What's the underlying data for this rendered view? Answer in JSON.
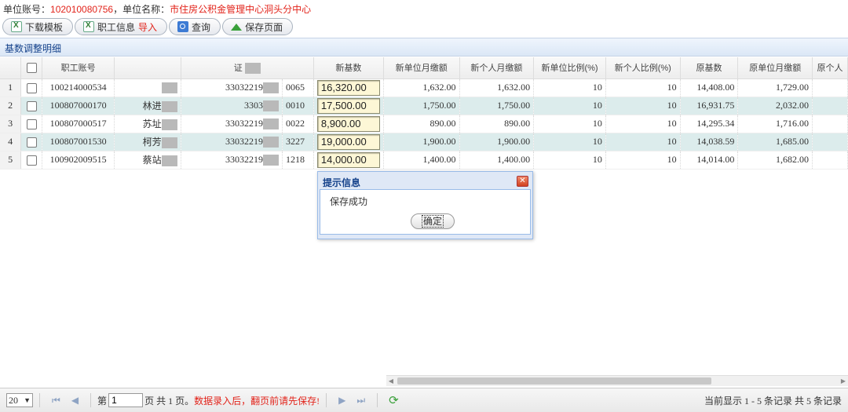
{
  "header": {
    "account_label": "单位账号：",
    "account_value": "102010080756",
    "sep": "，",
    "name_label": "单位名称：",
    "name_value": "市住房公积金管理中心洞头分中心"
  },
  "toolbar": {
    "download": "下载模板",
    "import_a": "职工信息",
    "import_b": "导入",
    "query": "查询",
    "save": "保存页面"
  },
  "panel": {
    "title": "基数调整明细"
  },
  "columns": [
    "职工账号",
    "",
    "证",
    "新基数",
    "新单位月缴额",
    "新个人月缴额",
    "新单位比例(%)",
    "新个人比例(%)",
    "原基数",
    "原单位月缴额",
    "原个人"
  ],
  "rows": [
    {
      "rn": "1",
      "account": "100214000534",
      "name": "",
      "id_a": "33032219",
      "id_b": "0065",
      "new_base": "16,320.00",
      "new_unit": "1,632.00",
      "new_person": "1,632.00",
      "unit_pct": "10",
      "person_pct": "10",
      "old_base": "14,408.00",
      "old_unit": "1,729.00"
    },
    {
      "rn": "2",
      "account": "100807000170",
      "name": "林进",
      "id_a": "3303",
      "id_b": "0010",
      "new_base": "17,500.00",
      "new_unit": "1,750.00",
      "new_person": "1,750.00",
      "unit_pct": "10",
      "person_pct": "10",
      "old_base": "16,931.75",
      "old_unit": "2,032.00"
    },
    {
      "rn": "3",
      "account": "100807000517",
      "name": "苏址",
      "id_a": "33032219",
      "id_b": "0022",
      "new_base": "8,900.00",
      "new_unit": "890.00",
      "new_person": "890.00",
      "unit_pct": "10",
      "person_pct": "10",
      "old_base": "14,295.34",
      "old_unit": "1,716.00"
    },
    {
      "rn": "4",
      "account": "100807001530",
      "name": "柯芳",
      "id_a": "33032219",
      "id_b": "3227",
      "new_base": "19,000.00",
      "new_unit": "1,900.00",
      "new_person": "1,900.00",
      "unit_pct": "10",
      "person_pct": "10",
      "old_base": "14,038.59",
      "old_unit": "1,685.00"
    },
    {
      "rn": "5",
      "account": "100902009515",
      "name": "蔡站",
      "id_a": "33032219",
      "id_b": "1218",
      "new_base": "14,000.00",
      "new_unit": "1,400.00",
      "new_person": "1,400.00",
      "unit_pct": "10",
      "person_pct": "10",
      "old_base": "14,014.00",
      "old_unit": "1,682.00"
    }
  ],
  "pager": {
    "page_size": "20",
    "page_label": "第",
    "page_value": "1",
    "page_total": "页 共 1 页。",
    "warning": "数据录入后，翻页前请先保存!",
    "status": "当前显示 1 - 5 条记录 共 5 条记录"
  },
  "dialog": {
    "title": "提示信息",
    "message": "保存成功",
    "ok": "确定"
  },
  "colors": {
    "accent_red": "#e2231a",
    "title_blue": "#15428b",
    "alt_row": "#dcecec"
  }
}
